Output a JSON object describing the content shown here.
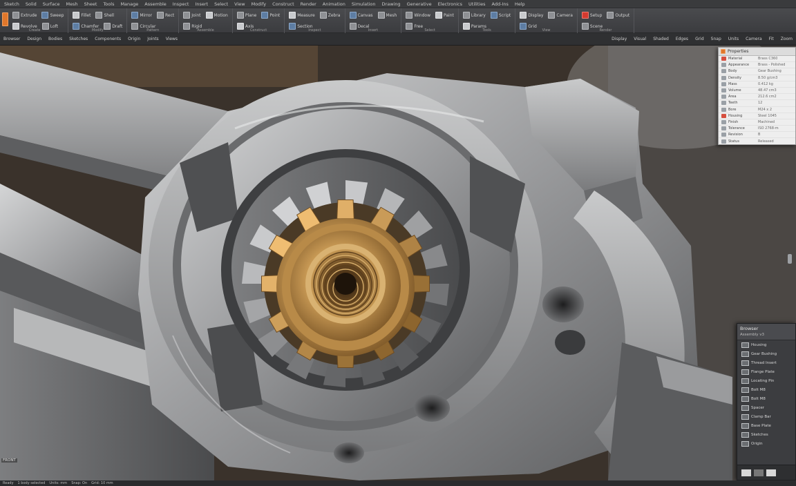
{
  "app": {
    "menu": [
      "Sketch",
      "Solid",
      "Surface",
      "Mesh",
      "Sheet",
      "Tools",
      "Manage",
      "Assemble",
      "Inspect",
      "Insert",
      "Select",
      "View",
      "Modify",
      "Construct",
      "Render",
      "Animation",
      "Simulation",
      "Drawing",
      "Generative",
      "Electronics",
      "Utilities",
      "Add-Ins",
      "Help"
    ]
  },
  "ribbon": {
    "groups": [
      {
        "label": "Create",
        "items": [
          "Extrude",
          "Revolve",
          "Sweep",
          "Loft"
        ]
      },
      {
        "label": "Modify",
        "items": [
          "Fillet",
          "Chamfer",
          "Shell",
          "Draft"
        ]
      },
      {
        "label": "Pattern",
        "items": [
          "Mirror",
          "Circular",
          "Rect"
        ]
      },
      {
        "label": "Assemble",
        "items": [
          "Joint",
          "Rigid",
          "Motion"
        ]
      },
      {
        "label": "Construct",
        "items": [
          "Plane",
          "Axis",
          "Point"
        ]
      },
      {
        "label": "Inspect",
        "items": [
          "Measure",
          "Section",
          "Zebra"
        ]
      },
      {
        "label": "Insert",
        "items": [
          "Canvas",
          "Decal",
          "Mesh"
        ]
      },
      {
        "label": "Select",
        "items": [
          "Window",
          "Free",
          "Paint"
        ]
      },
      {
        "label": "Tools",
        "items": [
          "Library",
          "Params",
          "Script"
        ]
      },
      {
        "label": "View",
        "items": [
          "Display",
          "Grid",
          "Camera"
        ]
      },
      {
        "label": "Render",
        "items": [
          "Setup",
          "Scene",
          "Output"
        ]
      }
    ]
  },
  "subbar": {
    "left": [
      "Browser",
      "Design",
      "Bodies",
      "Sketches",
      "Components",
      "Origin",
      "Joints",
      "Views"
    ],
    "right": [
      "Display",
      "Visual",
      "Shaded",
      "Edges",
      "Grid",
      "Snap",
      "Units",
      "Camera",
      "Fit",
      "Zoom"
    ]
  },
  "properties_panel": {
    "title": "Properties",
    "rows": [
      {
        "key": "Material",
        "value": "Brass C360"
      },
      {
        "key": "Appearance",
        "value": "Brass - Polished"
      },
      {
        "key": "Body",
        "value": "Gear Bushing"
      },
      {
        "key": "Density",
        "value": "8.50 g/cm3"
      },
      {
        "key": "Mass",
        "value": "0.412 kg"
      },
      {
        "key": "Volume",
        "value": "48.47 cm3"
      },
      {
        "key": "Area",
        "value": "212.6 cm2"
      },
      {
        "key": "Teeth",
        "value": "12"
      },
      {
        "key": "Bore",
        "value": "M24 x 2"
      },
      {
        "key": "Housing",
        "value": "Steel 1045"
      },
      {
        "key": "Finish",
        "value": "Machined"
      },
      {
        "key": "Tolerance",
        "value": "ISO 2768-m"
      },
      {
        "key": "Revision",
        "value": "B"
      },
      {
        "key": "Status",
        "value": "Released"
      }
    ]
  },
  "browser_panel": {
    "title": "Browser",
    "subtitle": "Assembly v3",
    "items": [
      "Housing",
      "Gear Bushing",
      "Thread Insert",
      "Flange Plate",
      "Locating Pin",
      "Bolt M8",
      "Bolt M8",
      "Spacer",
      "Clamp Bar",
      "Base Plate",
      "Sketches",
      "Origin"
    ]
  },
  "viewport": {
    "label": "FRONT"
  },
  "status": [
    "Ready",
    "1 body selected",
    "Units: mm",
    "Snap: On",
    "Grid: 10 mm"
  ],
  "colors": {
    "accent": "#e0772b",
    "brass": "#c89a55",
    "steel": "#a9aaac"
  }
}
